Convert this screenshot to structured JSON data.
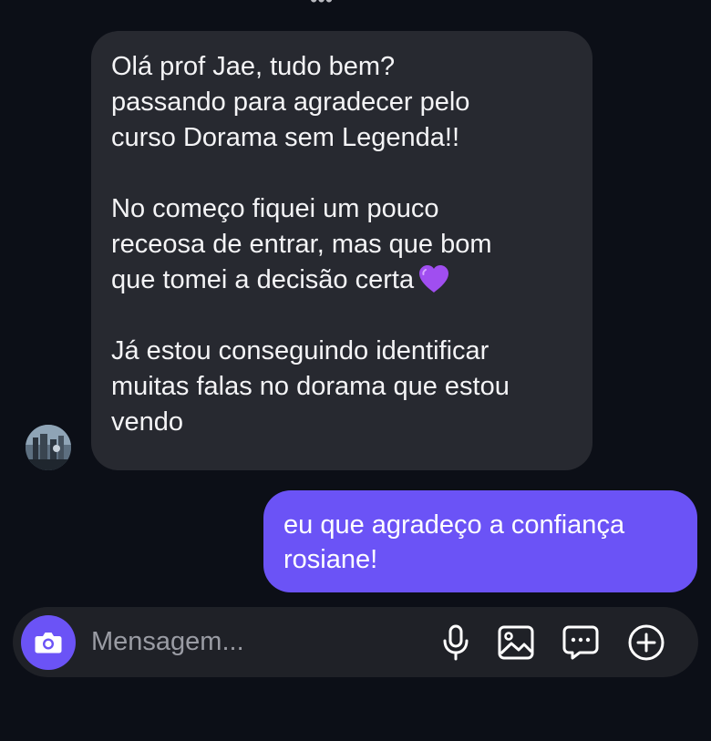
{
  "thread": {
    "top_fade_text": "•••",
    "incoming": {
      "paragraphs": [
        "Olá prof Jae, tudo bem?\npassando para agradecer pelo\ncurso Dorama sem Legenda!!",
        "No começo fiquei um pouco\nreceosa de entrar, mas que bom\nque tomei a decisão certa",
        "Já estou conseguindo identificar\nmuitas falas no dorama que estou\nvendo"
      ],
      "emoji": "purple-heart",
      "bubble_color": "#272930"
    },
    "outgoing": {
      "text": "eu que agradeço a confiança\nrosiane!",
      "bubble_color": "#6b53f6"
    }
  },
  "composer": {
    "placeholder": "Mensagem...",
    "icons": [
      "camera-icon",
      "microphone-icon",
      "gallery-icon",
      "sticker-icon",
      "plus-icon"
    ],
    "accent": "#6b53f6"
  }
}
